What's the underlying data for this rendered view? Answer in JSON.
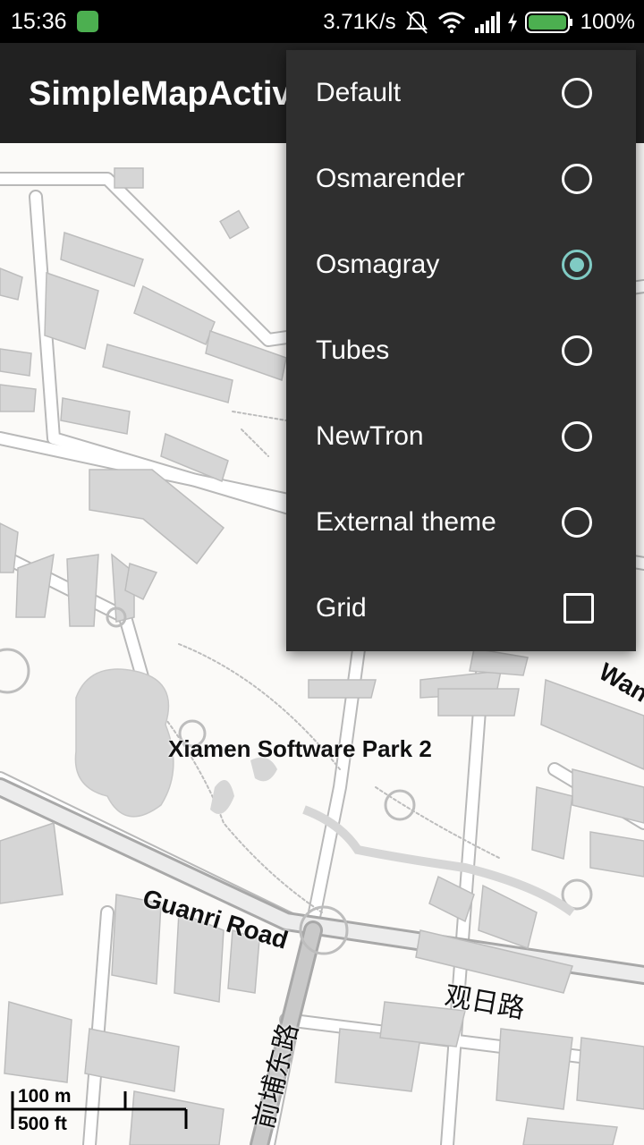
{
  "status_bar": {
    "time": "15:36",
    "network_speed": "3.71K/s",
    "battery": "100%",
    "icons": [
      "app-notification-icon",
      "mute-icon",
      "wifi-icon",
      "signal-icon",
      "charging-icon",
      "battery-icon"
    ]
  },
  "app_bar": {
    "title": "SimpleMapActivity"
  },
  "menu": {
    "items": [
      {
        "label": "Default",
        "control": "radio",
        "checked": false
      },
      {
        "label": "Osmarender",
        "control": "radio",
        "checked": false
      },
      {
        "label": "Osmagray",
        "control": "radio",
        "checked": true
      },
      {
        "label": "Tubes",
        "control": "radio",
        "checked": false
      },
      {
        "label": "NewTron",
        "control": "radio",
        "checked": false
      },
      {
        "label": "External theme",
        "control": "radio",
        "checked": false
      },
      {
        "label": "Grid",
        "control": "checkbox",
        "checked": false
      }
    ]
  },
  "map": {
    "labels": {
      "park": "Xiamen Software Park 2",
      "road_guanri": "Guanri Road",
      "road_guanri_cn": "观日路",
      "road_qianpu_cn": "前埔东路",
      "road_partial": "Wan"
    },
    "scale": {
      "metric": "100 m",
      "imperial": "500 ft"
    }
  },
  "colors": {
    "accent": "#80cbc4",
    "menu_bg": "#2f2f2f",
    "appbar_bg": "#212121"
  }
}
